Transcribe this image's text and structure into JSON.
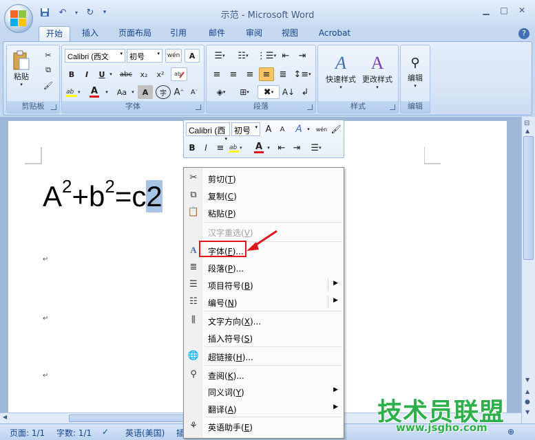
{
  "title_bar": {
    "title": "示范 - Microsoft Word",
    "qat": [
      "save-icon",
      "undo-icon",
      "redo-icon",
      "customize-icon"
    ]
  },
  "tabs": [
    "开始",
    "插入",
    "页面布局",
    "引用",
    "邮件",
    "审阅",
    "视图",
    "Acrobat"
  ],
  "ribbon": {
    "clipboard": {
      "label": "剪贴板",
      "paste": "粘贴"
    },
    "font": {
      "label": "字体",
      "font_name": "Calibri (西文",
      "font_size": "初号",
      "bold": "B",
      "italic": "I",
      "underline": "U",
      "strike": "abc",
      "subscript": "x₂",
      "superscript": "x²",
      "grow": "A",
      "shrink": "A",
      "change_case": "Aa",
      "char_shading": "A",
      "enclose": "字",
      "phonetic": "wén",
      "char_border": "A"
    },
    "paragraph": {
      "label": "段落"
    },
    "styles": {
      "label": "样式",
      "quick_styles": "快速样式",
      "change_styles": "更改样式"
    },
    "editing": {
      "label": "编辑",
      "edit": "编辑"
    }
  },
  "document": {
    "equation": {
      "a": "A",
      "exp1": "2",
      "plus_b": "+b",
      "exp2": "2",
      "equals_c": "=c",
      "selected": "2"
    },
    "para_mark": "↵"
  },
  "mini_toolbar": {
    "font_name": "Calibri (西",
    "font_size": "初号",
    "bold": "B",
    "italic": "I",
    "grow": "A",
    "shrink": "A",
    "styles": "A",
    "phonetic": "wén"
  },
  "context_menu": {
    "items": [
      {
        "label": "剪切",
        "key": "T"
      },
      {
        "label": "复制",
        "key": "C"
      },
      {
        "label": "粘贴",
        "key": "P"
      },
      {
        "label": "汉字重选",
        "key": "V"
      },
      {
        "label": "字体",
        "key": "F",
        "ellipsis": "..."
      },
      {
        "label": "段落",
        "key": "P",
        "ellipsis": "..."
      },
      {
        "label": "项目符号",
        "key": "B"
      },
      {
        "label": "编号",
        "key": "N"
      },
      {
        "label": "文字方向",
        "key": "X",
        "ellipsis": "..."
      },
      {
        "label": "插入符号",
        "key": "S"
      },
      {
        "label": "超链接",
        "key": "H",
        "ellipsis": "..."
      },
      {
        "label": "查阅",
        "key": "K",
        "ellipsis": "..."
      },
      {
        "label": "同义词",
        "key": "Y"
      },
      {
        "label": "翻译",
        "key": "A"
      },
      {
        "label": "英语助手",
        "key": "E"
      }
    ]
  },
  "status_bar": {
    "page": "页面: 1/1",
    "words": "字数: 1/1",
    "language": "英语(美国)",
    "insert": "插"
  },
  "watermark": {
    "big": "技术员联盟",
    "small": "www.jsgho.com"
  },
  "colors": {
    "accent": "#15428b",
    "highlight_annotation": "#e0151b",
    "watermark": "#2db04a"
  }
}
